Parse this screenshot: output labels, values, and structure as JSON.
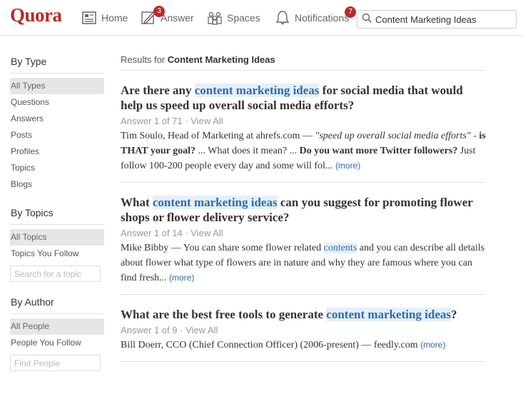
{
  "header": {
    "logo": "Quora",
    "nav": [
      {
        "label": "Home",
        "icon": "home-icon",
        "badge": ""
      },
      {
        "label": "Answer",
        "icon": "pencil-icon",
        "badge": "3"
      },
      {
        "label": "Spaces",
        "icon": "spaces-icon",
        "badge": ""
      },
      {
        "label": "Notifications",
        "icon": "bell-icon",
        "badge": "7"
      }
    ],
    "search": {
      "value": "Content Marketing Ideas",
      "icon": "search-icon"
    }
  },
  "sidebar": {
    "type": {
      "heading": "By Type",
      "items": [
        "All Types",
        "Questions",
        "Answers",
        "Posts",
        "Profiles",
        "Topics",
        "Blogs"
      ],
      "selected": "All Types"
    },
    "topics": {
      "heading": "By Topics",
      "items": [
        "All Topics",
        "Topics You Follow"
      ],
      "selected": "All Topics",
      "input_placeholder": "Search for a topic"
    },
    "author": {
      "heading": "By Author",
      "items": [
        "All People",
        "People You Follow"
      ],
      "selected": "All People",
      "input_placeholder": "Find People"
    }
  },
  "results": {
    "prefix": "Results for",
    "query": "Content Marketing Ideas",
    "items": [
      {
        "title": [
          {
            "text": "Are there any ",
            "hl": false
          },
          {
            "text": "content marketing ideas",
            "hl": true
          },
          {
            "text": " for social media that would help us speed up overall social media efforts?",
            "hl": false
          }
        ],
        "meta_answer": "Answer 1 of 71",
        "meta_view": "View All",
        "snippet": [
          {
            "text": "Tim Soulo, Head of Marketing at ahrefs.com — ",
            "style": ""
          },
          {
            "text": "\"speed up overall social media efforts\"",
            "style": "i"
          },
          {
            "text": " - ",
            "style": ""
          },
          {
            "text": "is THAT your goal?",
            "style": "b"
          },
          {
            "text": " ... What does it mean? ... ",
            "style": ""
          },
          {
            "text": "Do you want more Twitter followers?",
            "style": "b"
          },
          {
            "text": " Just follow 100-200 people every day and some will fol... ",
            "style": ""
          }
        ],
        "more": "(more)"
      },
      {
        "title": [
          {
            "text": "What ",
            "hl": false
          },
          {
            "text": "content marketing ideas",
            "hl": true
          },
          {
            "text": " can you suggest for promoting flower shops or flower delivery service?",
            "hl": false
          }
        ],
        "meta_answer": "Answer 1 of 14",
        "meta_view": "View All",
        "snippet": [
          {
            "text": "Mike Bibby — You can share some flower related ",
            "style": ""
          },
          {
            "text": "contents",
            "style": "hl"
          },
          {
            "text": " and you can describe all details about flower what type of flowers are in nature and why they are famous where you can find fresh... ",
            "style": ""
          }
        ],
        "more": "(more)"
      },
      {
        "title": [
          {
            "text": "What are the best free tools to generate ",
            "hl": false
          },
          {
            "text": "content marketing ideas",
            "hl": true
          },
          {
            "text": "?",
            "hl": false
          }
        ],
        "meta_answer": "Answer 1 of 9",
        "meta_view": "View All",
        "snippet": [
          {
            "text": "Bill Doerr, CCO (Chief Connection Officer) (2006-present) — feedly.com ",
            "style": ""
          }
        ],
        "more": "(more)"
      }
    ]
  },
  "colors": {
    "brand": "#b92b27",
    "highlight_bg": "#e6eff8",
    "link": "#2b6dad"
  }
}
